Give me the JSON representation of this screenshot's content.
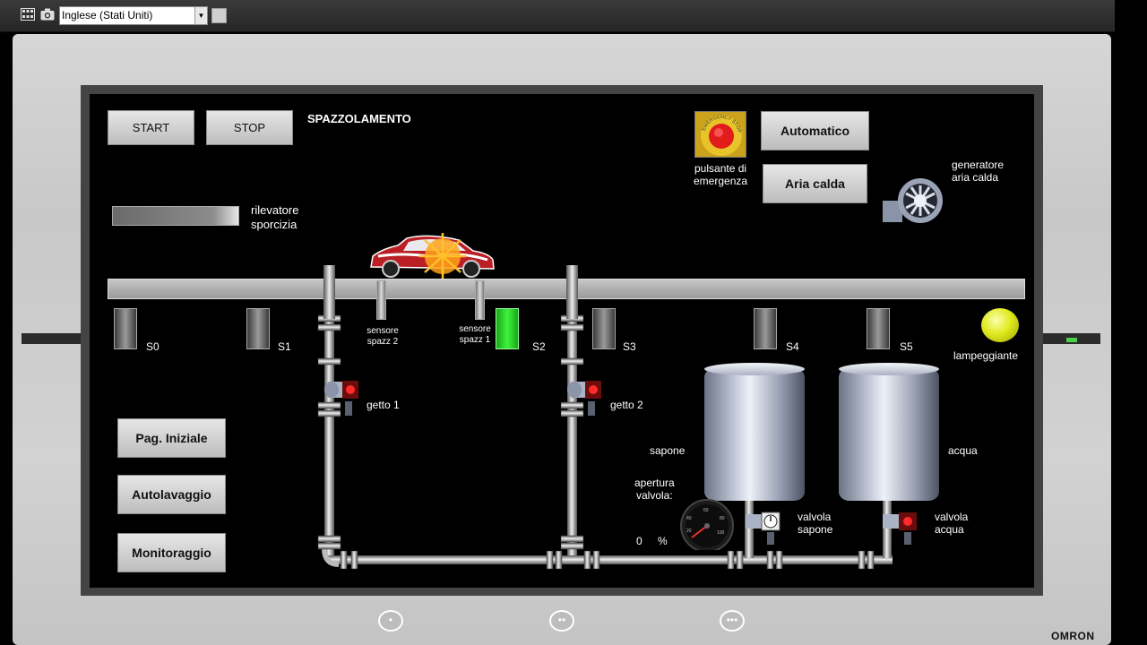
{
  "toolbar": {
    "language": "Inglese (Stati Uniti)",
    "icons": [
      "grid-icon",
      "camera-icon"
    ]
  },
  "hmi": {
    "start_label": "START",
    "stop_label": "STOP",
    "phase_title": "SPAZZOLAMENTO",
    "dirt_detector_label": "rilevatore\nsporcizia",
    "emergency": {
      "badge": "EMERGENCY STOP",
      "label": "pulsante di\nemergenza"
    },
    "automatic_label": "Automatico",
    "hot_air_label": "Aria calda",
    "hot_air_generator_label": "generatore\naria calda",
    "sensors": [
      "S0",
      "S1",
      "S2",
      "S3",
      "S4",
      "S5"
    ],
    "brush_sensors": [
      "sensore\nspazz 2",
      "sensore\nspazz 1"
    ],
    "jets": [
      "getto 1",
      "getto 2"
    ],
    "flashing_light_label": "lampeggiante",
    "nav": {
      "home": "Pag. Iniziale",
      "carwash": "Autolavaggio",
      "monitoring": "Monitoraggio"
    },
    "tanks": {
      "soap": "sapone",
      "water": "acqua"
    },
    "valve_opening": {
      "label": "apertura\nvalvola:",
      "value": "0",
      "unit": "%",
      "gauge_ticks": [
        "20",
        "40",
        "60",
        "80",
        "100"
      ]
    },
    "valves": {
      "soap": "valvola\nsapone",
      "water": "valvola\nacqua"
    },
    "sensor_states": {
      "S0": false,
      "S1": false,
      "S2": true,
      "S3": false,
      "S4": false,
      "S5": false
    },
    "colors": {
      "active_sensor": "#3ef23e",
      "lamp": "#e0ea1e",
      "emergency": "#e21b1b"
    }
  },
  "device": {
    "brand": "OMRON",
    "hw_buttons": [
      "•",
      "••",
      "•••"
    ]
  }
}
